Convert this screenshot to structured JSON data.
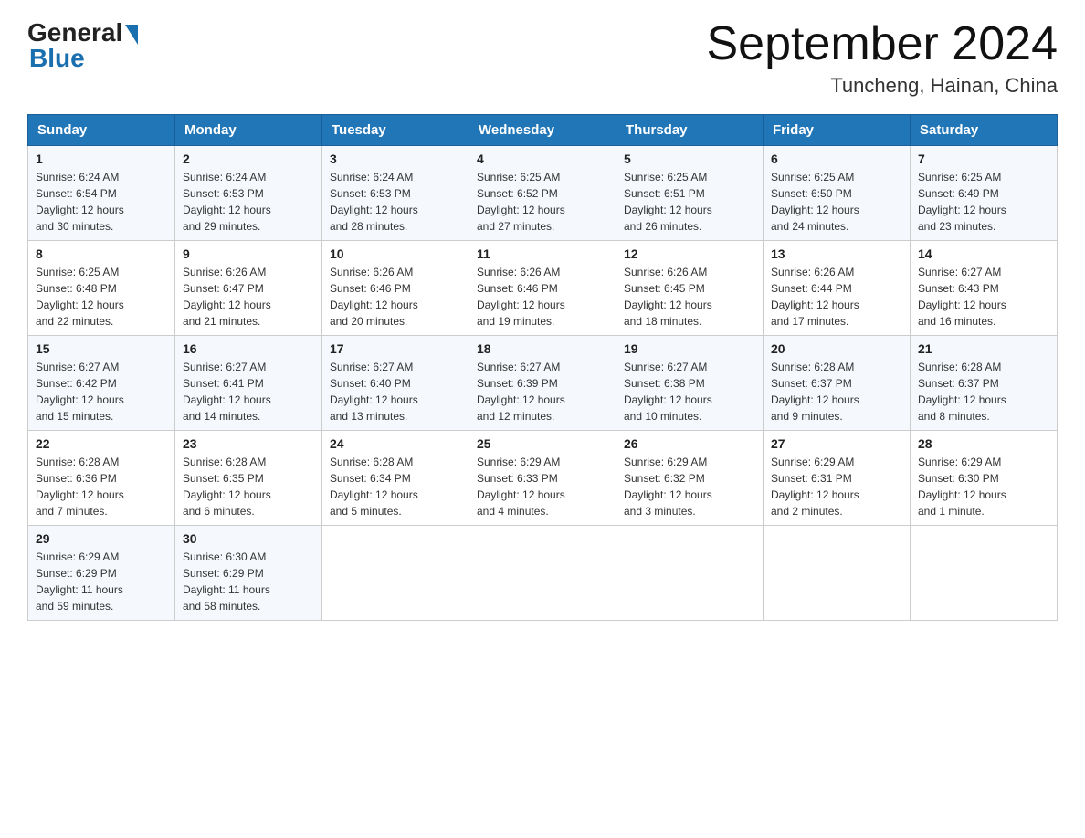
{
  "header": {
    "logo_general": "General",
    "logo_blue": "Blue",
    "month_title": "September 2024",
    "location": "Tuncheng, Hainan, China"
  },
  "calendar": {
    "days_of_week": [
      "Sunday",
      "Monday",
      "Tuesday",
      "Wednesday",
      "Thursday",
      "Friday",
      "Saturday"
    ],
    "weeks": [
      [
        {
          "day": "1",
          "sunrise": "6:24 AM",
          "sunset": "6:54 PM",
          "daylight": "12 hours and 30 minutes."
        },
        {
          "day": "2",
          "sunrise": "6:24 AM",
          "sunset": "6:53 PM",
          "daylight": "12 hours and 29 minutes."
        },
        {
          "day": "3",
          "sunrise": "6:24 AM",
          "sunset": "6:53 PM",
          "daylight": "12 hours and 28 minutes."
        },
        {
          "day": "4",
          "sunrise": "6:25 AM",
          "sunset": "6:52 PM",
          "daylight": "12 hours and 27 minutes."
        },
        {
          "day": "5",
          "sunrise": "6:25 AM",
          "sunset": "6:51 PM",
          "daylight": "12 hours and 26 minutes."
        },
        {
          "day": "6",
          "sunrise": "6:25 AM",
          "sunset": "6:50 PM",
          "daylight": "12 hours and 24 minutes."
        },
        {
          "day": "7",
          "sunrise": "6:25 AM",
          "sunset": "6:49 PM",
          "daylight": "12 hours and 23 minutes."
        }
      ],
      [
        {
          "day": "8",
          "sunrise": "6:25 AM",
          "sunset": "6:48 PM",
          "daylight": "12 hours and 22 minutes."
        },
        {
          "day": "9",
          "sunrise": "6:26 AM",
          "sunset": "6:47 PM",
          "daylight": "12 hours and 21 minutes."
        },
        {
          "day": "10",
          "sunrise": "6:26 AM",
          "sunset": "6:46 PM",
          "daylight": "12 hours and 20 minutes."
        },
        {
          "day": "11",
          "sunrise": "6:26 AM",
          "sunset": "6:46 PM",
          "daylight": "12 hours and 19 minutes."
        },
        {
          "day": "12",
          "sunrise": "6:26 AM",
          "sunset": "6:45 PM",
          "daylight": "12 hours and 18 minutes."
        },
        {
          "day": "13",
          "sunrise": "6:26 AM",
          "sunset": "6:44 PM",
          "daylight": "12 hours and 17 minutes."
        },
        {
          "day": "14",
          "sunrise": "6:27 AM",
          "sunset": "6:43 PM",
          "daylight": "12 hours and 16 minutes."
        }
      ],
      [
        {
          "day": "15",
          "sunrise": "6:27 AM",
          "sunset": "6:42 PM",
          "daylight": "12 hours and 15 minutes."
        },
        {
          "day": "16",
          "sunrise": "6:27 AM",
          "sunset": "6:41 PM",
          "daylight": "12 hours and 14 minutes."
        },
        {
          "day": "17",
          "sunrise": "6:27 AM",
          "sunset": "6:40 PM",
          "daylight": "12 hours and 13 minutes."
        },
        {
          "day": "18",
          "sunrise": "6:27 AM",
          "sunset": "6:39 PM",
          "daylight": "12 hours and 12 minutes."
        },
        {
          "day": "19",
          "sunrise": "6:27 AM",
          "sunset": "6:38 PM",
          "daylight": "12 hours and 10 minutes."
        },
        {
          "day": "20",
          "sunrise": "6:28 AM",
          "sunset": "6:37 PM",
          "daylight": "12 hours and 9 minutes."
        },
        {
          "day": "21",
          "sunrise": "6:28 AM",
          "sunset": "6:37 PM",
          "daylight": "12 hours and 8 minutes."
        }
      ],
      [
        {
          "day": "22",
          "sunrise": "6:28 AM",
          "sunset": "6:36 PM",
          "daylight": "12 hours and 7 minutes."
        },
        {
          "day": "23",
          "sunrise": "6:28 AM",
          "sunset": "6:35 PM",
          "daylight": "12 hours and 6 minutes."
        },
        {
          "day": "24",
          "sunrise": "6:28 AM",
          "sunset": "6:34 PM",
          "daylight": "12 hours and 5 minutes."
        },
        {
          "day": "25",
          "sunrise": "6:29 AM",
          "sunset": "6:33 PM",
          "daylight": "12 hours and 4 minutes."
        },
        {
          "day": "26",
          "sunrise": "6:29 AM",
          "sunset": "6:32 PM",
          "daylight": "12 hours and 3 minutes."
        },
        {
          "day": "27",
          "sunrise": "6:29 AM",
          "sunset": "6:31 PM",
          "daylight": "12 hours and 2 minutes."
        },
        {
          "day": "28",
          "sunrise": "6:29 AM",
          "sunset": "6:30 PM",
          "daylight": "12 hours and 1 minute."
        }
      ],
      [
        {
          "day": "29",
          "sunrise": "6:29 AM",
          "sunset": "6:29 PM",
          "daylight": "11 hours and 59 minutes."
        },
        {
          "day": "30",
          "sunrise": "6:30 AM",
          "sunset": "6:29 PM",
          "daylight": "11 hours and 58 minutes."
        },
        null,
        null,
        null,
        null,
        null
      ]
    ],
    "labels": {
      "sunrise": "Sunrise:",
      "sunset": "Sunset:",
      "daylight": "Daylight:"
    }
  }
}
